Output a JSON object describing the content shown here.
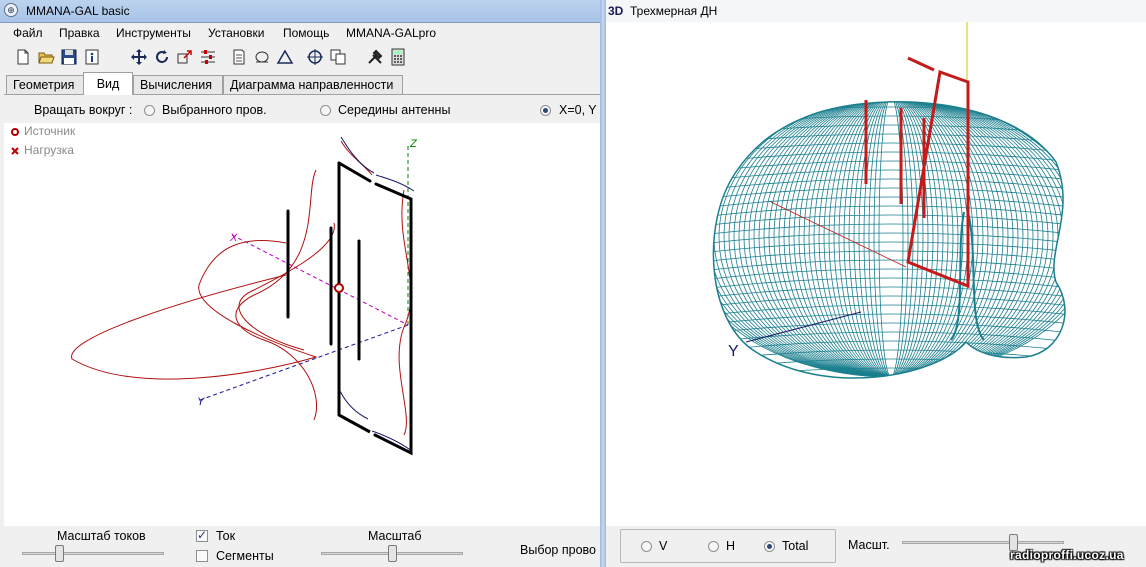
{
  "left_window": {
    "title": "MMANA-GAL basic",
    "menu": [
      "Файл",
      "Правка",
      "Инструменты",
      "Установки",
      "Помощь",
      "MMANA-GALpro"
    ],
    "toolbar_icons": [
      "new-file-icon",
      "open-folder-icon",
      "save-disk-icon",
      "info-icon",
      "move-arrows-icon",
      "rotate-icon",
      "resize-icon",
      "equalizer-icon",
      "document-icon",
      "zoom-icon",
      "triangle-icon",
      "target-icon",
      "copy-icon",
      "tools-icon",
      "calculator-icon"
    ],
    "tabs": [
      {
        "label": "Геометрия",
        "active": false
      },
      {
        "label": "Вид",
        "active": true
      },
      {
        "label": "Вычисления",
        "active": false
      },
      {
        "label": "Диаграмма направленности",
        "active": false
      }
    ],
    "rotate": {
      "label": "Вращать вокруг :",
      "options": [
        "Выбранного пров.",
        "Середины антенны",
        "X=0, Y"
      ],
      "selected": "X=0, Y"
    },
    "legend": {
      "source": "Источник",
      "load": "Нагрузка",
      "source_color": "#b00000",
      "load_color": "#c00000"
    },
    "axis_labels": {
      "x": "X",
      "y": "Y",
      "z": "Z"
    },
    "bottom": {
      "current_scale_label": "Масштаб токов",
      "current_scale": 0.25,
      "chk_current": {
        "label": "Ток",
        "checked": true
      },
      "chk_segments": {
        "label": "Сегменты",
        "checked": false
      },
      "scale_label": "Масштаб",
      "scale": 0.5,
      "wire_select_label": "Выбор прово"
    }
  },
  "right_window": {
    "icon_text": "3D",
    "title": "Трехмерная ДН",
    "axis_labels": {
      "y": "Y"
    },
    "pattern_color": "#1a7f8e",
    "antenna_color": "#c41a1a",
    "polarization": {
      "options": [
        "V",
        "H",
        "Total"
      ],
      "selected": "Total"
    },
    "scale_label": "Масшт.",
    "scale": 0.7
  },
  "watermark": "radioproffi.ucoz.ua"
}
